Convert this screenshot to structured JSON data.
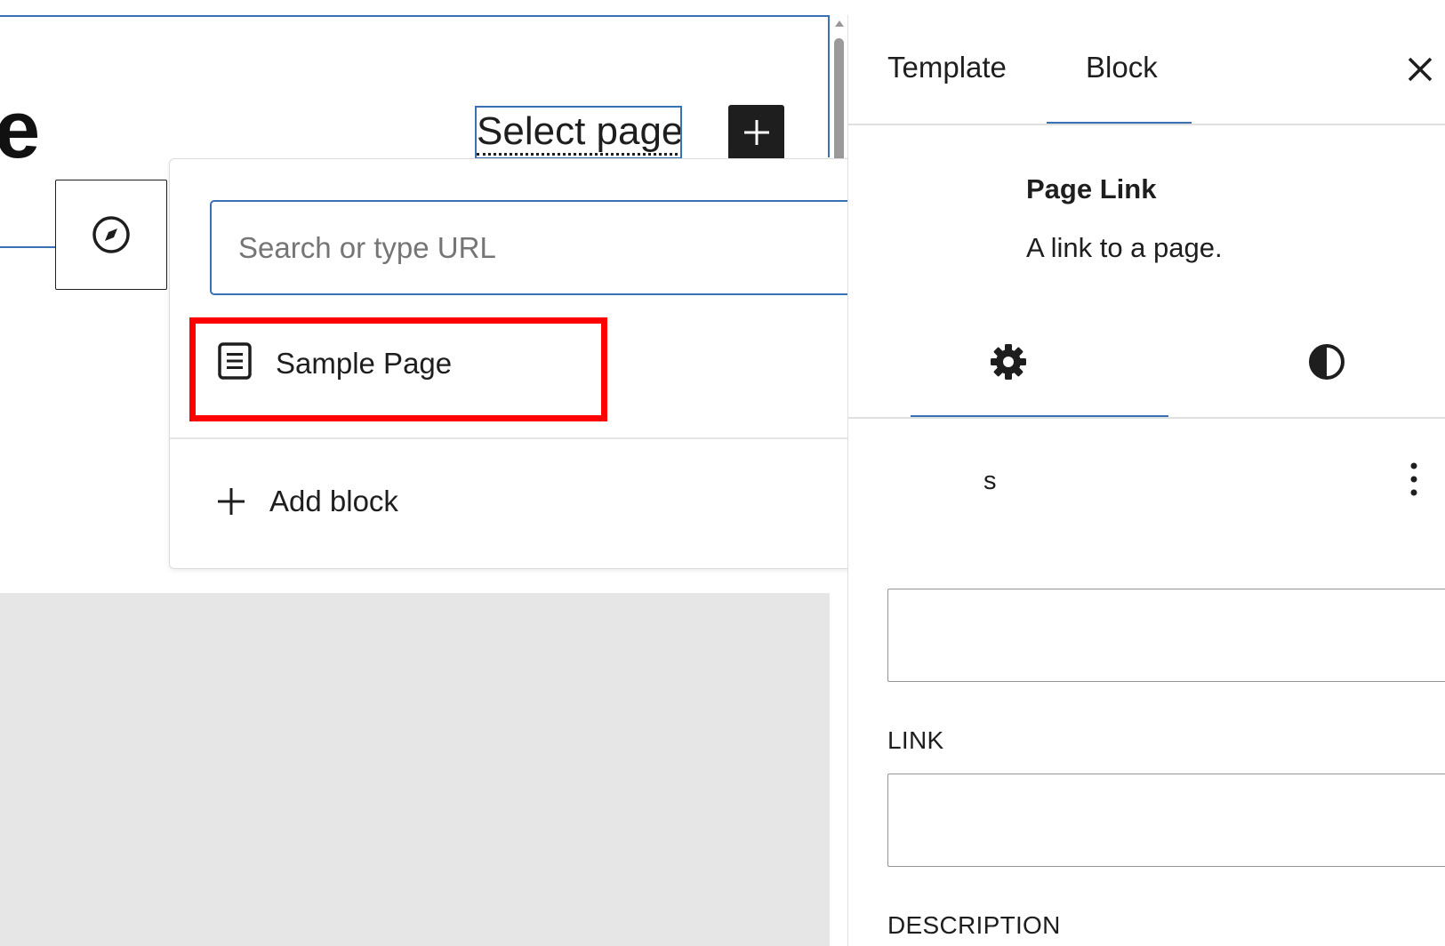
{
  "canvas": {
    "heading_fragment": "e",
    "select_page_text": "Select page"
  },
  "link_popover": {
    "search_placeholder": "Search or type URL",
    "results": [
      {
        "label": "Sample Page",
        "icon": "page-icon"
      }
    ],
    "add_block_label": "Add block"
  },
  "sidebar": {
    "tabs": [
      {
        "label": "Template",
        "active": false
      },
      {
        "label": "Block",
        "active": true
      }
    ],
    "block": {
      "title": "Page Link",
      "description": "A link to a page."
    },
    "subtabs": [
      {
        "icon": "gear-icon",
        "active": true
      },
      {
        "icon": "contrast-icon",
        "active": false
      }
    ],
    "panel_title_fragment": "s",
    "fields": {
      "link_label": "LINK",
      "description_label": "DESCRIPTION"
    }
  },
  "colors": {
    "accent": "#3871b4",
    "highlight": "#ff0000",
    "canvas_gray": "#e6e6e6"
  }
}
